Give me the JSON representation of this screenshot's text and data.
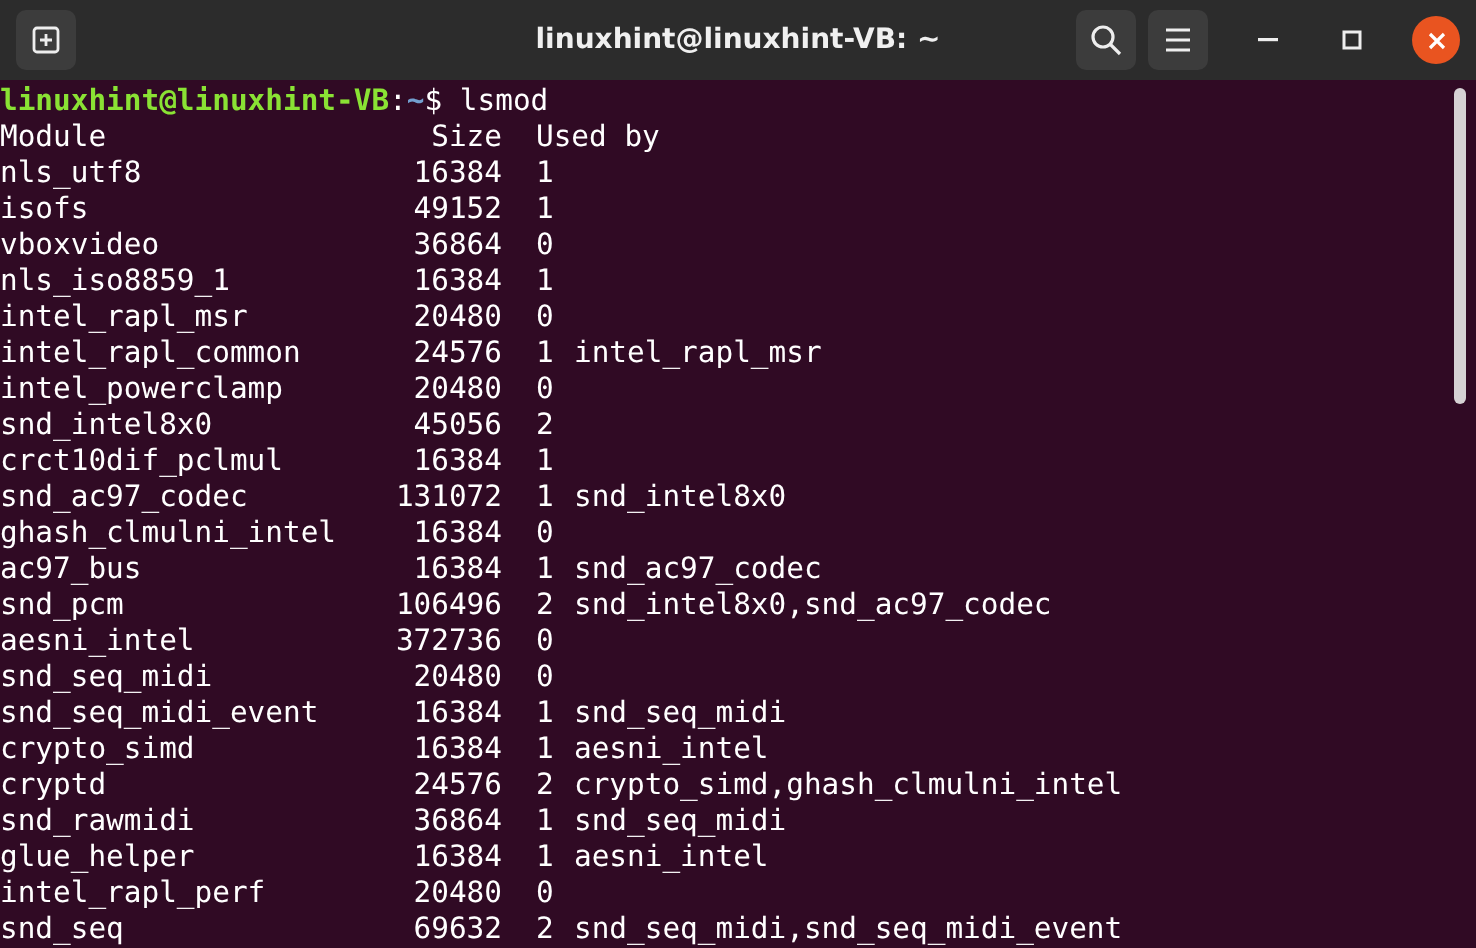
{
  "window": {
    "title": "linuxhint@linuxhint-VB: ~"
  },
  "prompt": {
    "user_host": "linuxhint@linuxhint-VB",
    "separator": ":",
    "path": "~",
    "command": "$ lsmod"
  },
  "table": {
    "columns": [
      "Module",
      "Size",
      "Used by"
    ],
    "rows": [
      {
        "module": "nls_utf8",
        "size": "16384",
        "count": "1"
      },
      {
        "module": "isofs",
        "size": "49152",
        "count": "1"
      },
      {
        "module": "vboxvideo",
        "size": "36864",
        "count": "0"
      },
      {
        "module": "nls_iso8859_1",
        "size": "16384",
        "count": "1"
      },
      {
        "module": "intel_rapl_msr",
        "size": "20480",
        "count": "0"
      },
      {
        "module": "intel_rapl_common",
        "size": "24576",
        "count": "1",
        "used_by": "intel_rapl_msr"
      },
      {
        "module": "intel_powerclamp",
        "size": "20480",
        "count": "0"
      },
      {
        "module": "snd_intel8x0",
        "size": "45056",
        "count": "2"
      },
      {
        "module": "crct10dif_pclmul",
        "size": "16384",
        "count": "1"
      },
      {
        "module": "snd_ac97_codec",
        "size": "131072",
        "count": "1",
        "used_by": "snd_intel8x0"
      },
      {
        "module": "ghash_clmulni_intel",
        "size": "16384",
        "count": "0"
      },
      {
        "module": "ac97_bus",
        "size": "16384",
        "count": "1",
        "used_by": "snd_ac97_codec"
      },
      {
        "module": "snd_pcm",
        "size": "106496",
        "count": "2",
        "used_by": "snd_intel8x0,snd_ac97_codec"
      },
      {
        "module": "aesni_intel",
        "size": "372736",
        "count": "0"
      },
      {
        "module": "snd_seq_midi",
        "size": "20480",
        "count": "0"
      },
      {
        "module": "snd_seq_midi_event",
        "size": "16384",
        "count": "1",
        "used_by": "snd_seq_midi"
      },
      {
        "module": "crypto_simd",
        "size": "16384",
        "count": "1",
        "used_by": "aesni_intel"
      },
      {
        "module": "cryptd",
        "size": "24576",
        "count": "2",
        "used_by": "crypto_simd,ghash_clmulni_intel"
      },
      {
        "module": "snd_rawmidi",
        "size": "36864",
        "count": "1",
        "used_by": "snd_seq_midi"
      },
      {
        "module": "glue_helper",
        "size": "16384",
        "count": "1",
        "used_by": "aesni_intel"
      },
      {
        "module": "intel_rapl_perf",
        "size": "20480",
        "count": "0"
      },
      {
        "module": "snd_seq",
        "size": "69632",
        "count": "2",
        "used_by": "snd_seq_midi,snd_seq_midi_event"
      }
    ]
  }
}
